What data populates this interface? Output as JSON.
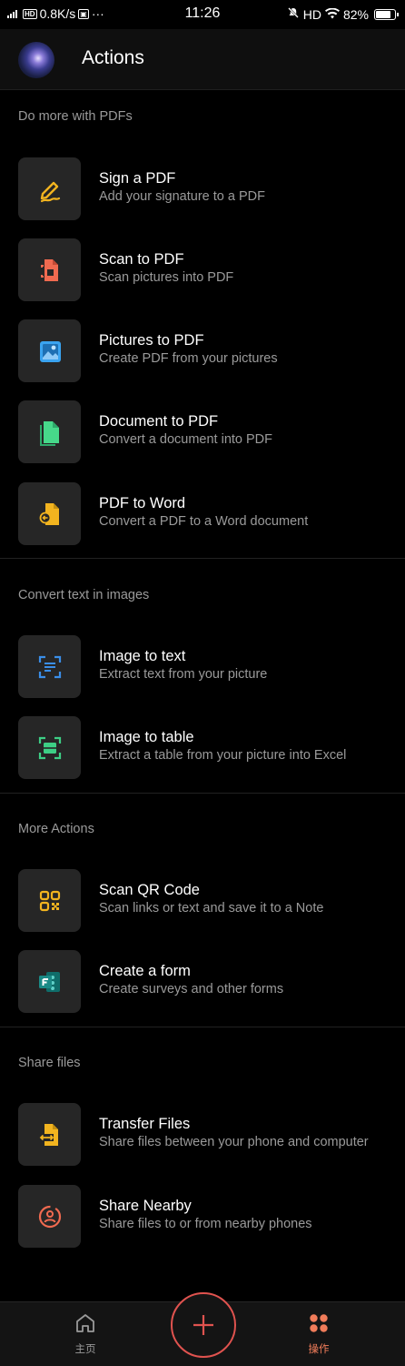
{
  "status_bar": {
    "speed": "0.8K/s",
    "time": "11:26",
    "network": "HD",
    "battery": "82%"
  },
  "header": {
    "title": "Actions"
  },
  "sections": [
    {
      "label": "Do more with PDFs",
      "items": [
        {
          "title": "Sign a PDF",
          "subtitle": "Add your signature to a PDF",
          "icon": "signature-pen-icon",
          "color": "#f2b41f"
        },
        {
          "title": "Scan to PDF",
          "subtitle": "Scan pictures into PDF",
          "icon": "scan-document-icon",
          "color": "#f06a50"
        },
        {
          "title": "Pictures to PDF",
          "subtitle": "Create PDF from your pictures",
          "icon": "picture-icon",
          "color": "#3aa3f0"
        },
        {
          "title": "Document to PDF",
          "subtitle": "Convert a document into PDF",
          "icon": "document-icon",
          "color": "#47d88a"
        },
        {
          "title": "PDF to Word",
          "subtitle": "Convert a PDF to a Word document",
          "icon": "pdf-to-word-icon",
          "color": "#f2b41f"
        }
      ]
    },
    {
      "label": "Convert text in images",
      "items": [
        {
          "title": "Image to text",
          "subtitle": "Extract text from your picture",
          "icon": "image-text-scan-icon",
          "color": "#3a8ee8"
        },
        {
          "title": "Image to table",
          "subtitle": "Extract a table from your picture into Excel",
          "icon": "image-table-scan-icon",
          "color": "#3dcf85"
        }
      ]
    },
    {
      "label": "More Actions",
      "items": [
        {
          "title": "Scan QR Code",
          "subtitle": "Scan links or text and save it to a Note",
          "icon": "qr-code-icon",
          "color": "#f2b41f"
        },
        {
          "title": "Create a form",
          "subtitle": "Create surveys and other forms",
          "icon": "forms-icon",
          "color": "#1b8a86"
        }
      ]
    },
    {
      "label": "Share files",
      "items": [
        {
          "title": "Transfer Files",
          "subtitle": "Share files between your phone and computer",
          "icon": "transfer-files-icon",
          "color": "#f2b41f"
        },
        {
          "title": "Share Nearby",
          "subtitle": "Share files to or from nearby phones",
          "icon": "share-nearby-icon",
          "color": "#f06a50"
        }
      ]
    }
  ],
  "bottom_nav": {
    "home_label": "主页",
    "actions_label": "操作",
    "active_color": "#f07c5a",
    "fab_color": "#e0534f"
  }
}
